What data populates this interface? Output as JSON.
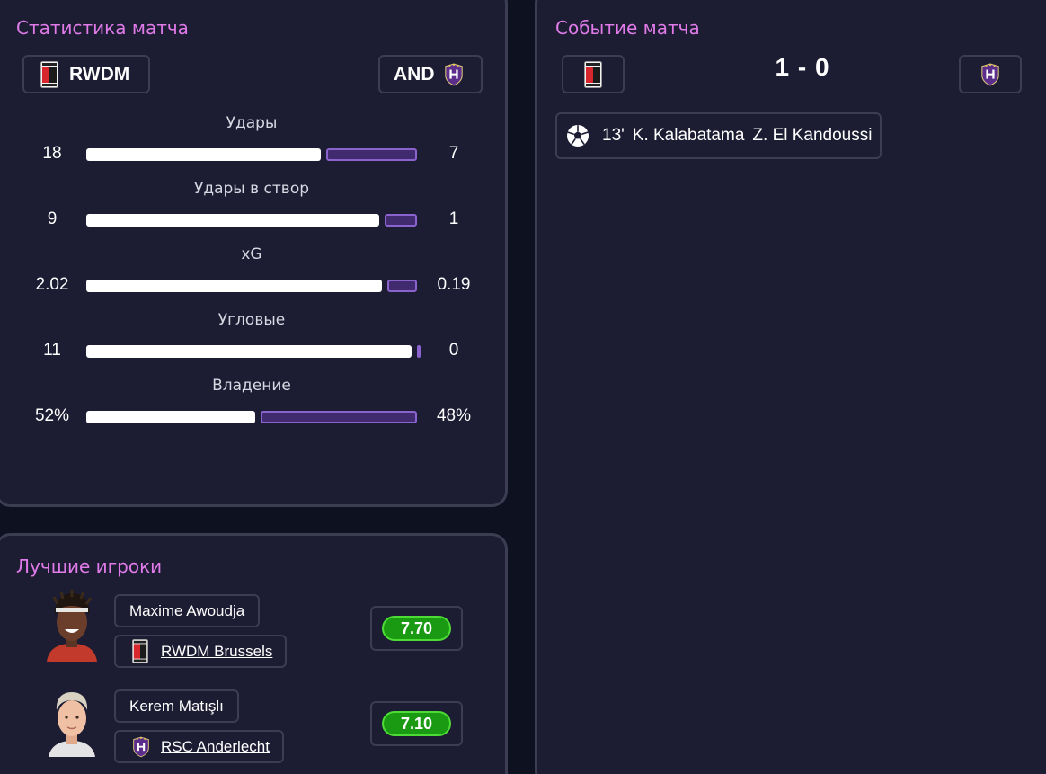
{
  "stats": {
    "title": "Статистика матча",
    "home_team": {
      "abbr": "RWDM",
      "crest_icon": "rwdm-crest-icon"
    },
    "away_team": {
      "abbr": "AND",
      "crest_icon": "anderlecht-crest-icon"
    },
    "rows": [
      {
        "label": "Удары",
        "home": "18",
        "away": "7",
        "home_share": 0.72
      },
      {
        "label": "Удары в створ",
        "home": "9",
        "away": "1",
        "home_share": 0.9
      },
      {
        "label": "xG",
        "home": "2.02",
        "away": "0.19",
        "home_share": 0.91
      },
      {
        "label": "Угловые",
        "home": "11",
        "away": "0",
        "home_share": 1.0
      },
      {
        "label": "Владение",
        "home": "52%",
        "away": "48%",
        "home_share": 0.52
      }
    ]
  },
  "events": {
    "title": "Событие матча",
    "score": "1 - 0",
    "home_crest_icon": "rwdm-crest-icon",
    "away_crest_icon": "anderlecht-crest-icon",
    "list": [
      {
        "icon": "soccer-ball-icon",
        "minute": "13'",
        "scorer": "K. Kalabatama",
        "assist": "Z. El Kandoussi"
      }
    ]
  },
  "players": {
    "title": "Лучшие игроки",
    "list": [
      {
        "name": "Maxime Awoudja",
        "club": "RWDM Brussels",
        "club_icon": "rwdm-crest-icon",
        "rating": "7.70"
      },
      {
        "name": "Kerem Matışlı",
        "club": "RSC Anderlecht",
        "club_icon": "anderlecht-crest-icon",
        "rating": "7.10"
      }
    ]
  },
  "colors": {
    "title_accent": "#e07be9",
    "home_bar": "#ffffff",
    "away_bar": "#3f2b6e",
    "rating_green": "#1a9a12",
    "panel_bg": "#1c1c33"
  }
}
